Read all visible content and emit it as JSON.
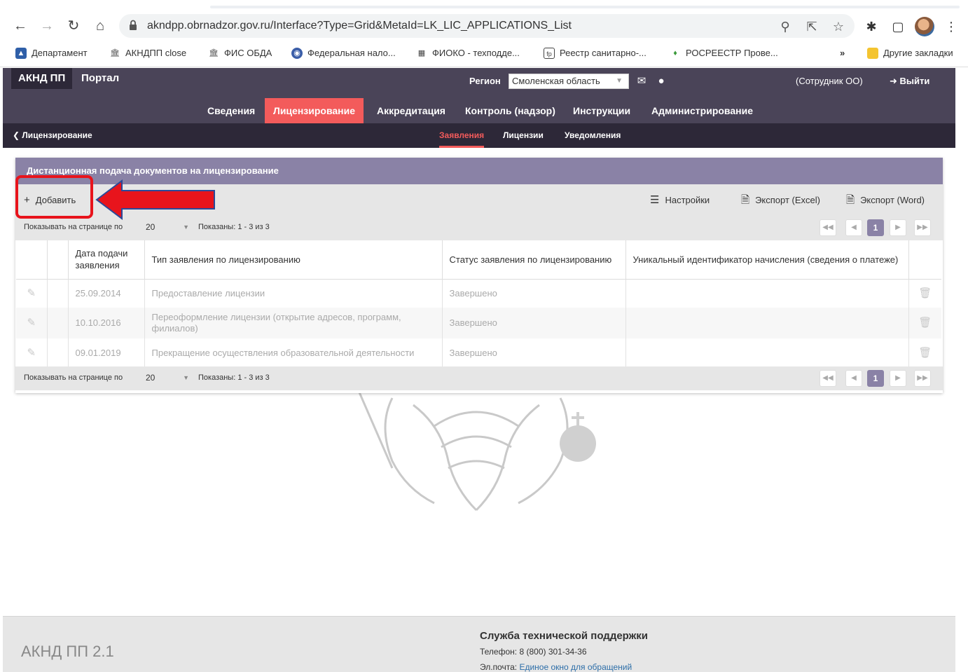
{
  "browser": {
    "url": "akndpp.obrnadzor.gov.ru/Interface?Type=Grid&MetaId=LK_LIC_APPLICATIONS_List",
    "bookmarks": [
      "Департамент",
      "АКНДПП close",
      "ФИС ОБДА",
      "Федеральная нало...",
      "ФИОКО - техподде...",
      "Реестр санитарно-...",
      "РОСРЕЕСТР Прове..."
    ],
    "overflow": "»",
    "other_bookmarks": "Другие закладки"
  },
  "header": {
    "brand": "АКНД ПП",
    "portal": "Портал",
    "region_label": "Регион",
    "region_value": "Смоленская область",
    "user_role": "(Сотрудник ОО)",
    "logout": "Выйти"
  },
  "main_nav": [
    "Сведения",
    "Лицензирование",
    "Аккредитация",
    "Контроль (надзор)",
    "Инструкции",
    "Администрирование"
  ],
  "sub_nav": {
    "breadcrumb": "Лицензирование",
    "tabs": [
      "Заявления",
      "Лицензии",
      "Уведомления"
    ]
  },
  "panel": {
    "title": "Дистанционная подача документов на лицензирование",
    "add": "Добавить",
    "settings": "Настройки",
    "export_excel": "Экспорт (Excel)",
    "export_word": "Экспорт (Word)"
  },
  "pager": {
    "per_page_label": "Показывать на странице по",
    "per_page": "20",
    "shown": "Показаны: 1 - 3 из 3",
    "current_page": "1"
  },
  "table": {
    "columns": [
      "Дата подачи заявления",
      "Тип заявления по лицензированию",
      "Статус заявления по лицензированию",
      "Уникальный идентификатор начисления (сведения о платеже)"
    ],
    "rows": [
      {
        "date": "25.09.2014",
        "type": "Предоставление лицензии",
        "status": "Завершено",
        "uid": ""
      },
      {
        "date": "10.10.2016",
        "type": "Переоформление лицензии (открытие адресов, программ, филиалов)",
        "status": "Завершено",
        "uid": ""
      },
      {
        "date": "09.01.2019",
        "type": "Прекращение осуществления образовательной деятельности",
        "status": "Завершено",
        "uid": ""
      }
    ]
  },
  "footer": {
    "brand": "АКНД ПП 2.1",
    "support_title": "Служба технической поддержки",
    "phone_label": "Телефон:",
    "phone": "8 (800) 301-34-36",
    "email_label": "Эл.почта:",
    "email_link": "Единое окно для обращений"
  },
  "colors": {
    "header_bg": "#4a4458",
    "subnav_bg": "#2d2838",
    "accent": "#f35b5b",
    "panel_title_bg": "#8a82a6",
    "annotation_red": "#e8141c"
  }
}
